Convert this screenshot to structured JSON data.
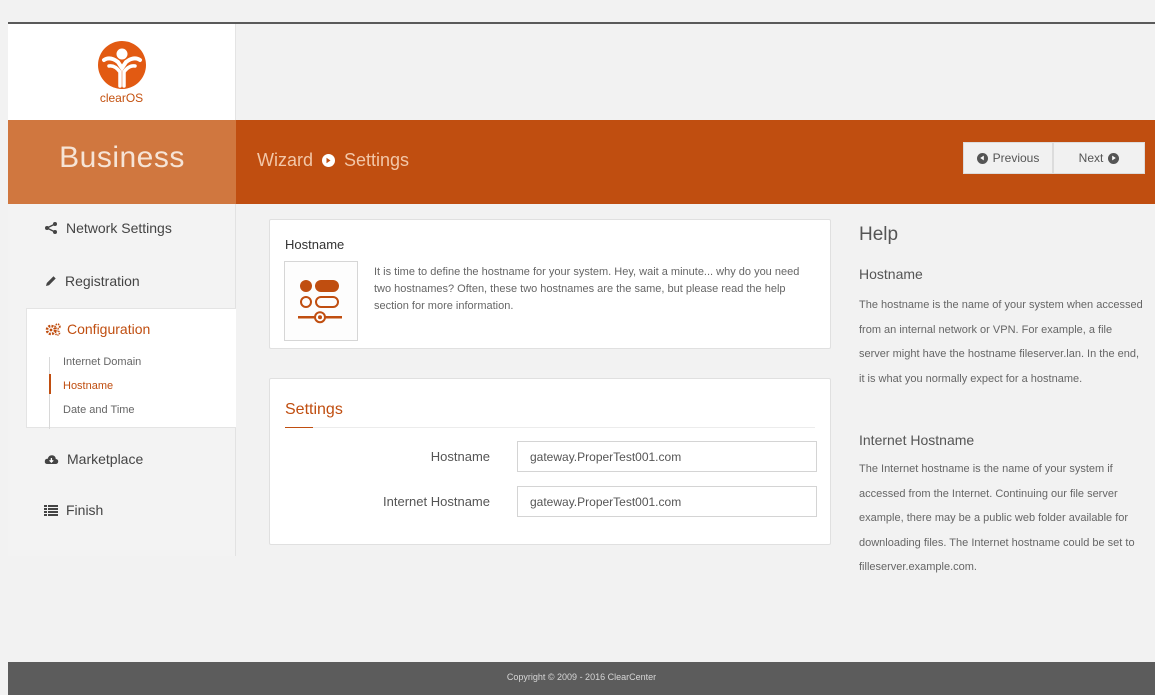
{
  "logo": {
    "text": "clearOS",
    "icon": "clearos-logo"
  },
  "banner": {
    "edition": "Business",
    "breadcrumb": {
      "wizard": "Wizard",
      "separator_icon": "circle-arrow-right-icon",
      "current": "Settings"
    },
    "previous_label": "Previous",
    "next_label": "Next"
  },
  "sidebar": {
    "items": [
      {
        "label": "Network Settings",
        "icon": "share-icon"
      },
      {
        "label": "Registration",
        "icon": "pencil-icon"
      },
      {
        "label": "Configuration",
        "icon": "cogs-icon",
        "active": true
      },
      {
        "label": "Marketplace",
        "icon": "cloud-icon"
      },
      {
        "label": "Finish",
        "icon": "list-icon"
      }
    ],
    "sub_items": [
      {
        "label": "Internet Domain"
      },
      {
        "label": "Hostname",
        "active": true
      },
      {
        "label": "Date and Time"
      }
    ]
  },
  "hostname_card": {
    "title": "Hostname",
    "description": "It is time to define the hostname for your system. Hey, wait a minute... why do you need two hostnames? Often, these two hostnames are the same, but please read the help section for more information."
  },
  "settings_card": {
    "title": "Settings",
    "fields": [
      {
        "label": "Hostname",
        "value": "gateway.ProperTest001.com"
      },
      {
        "label": "Internet Hostname",
        "value": "gateway.ProperTest001.com"
      }
    ]
  },
  "help": {
    "title": "Help",
    "sections": [
      {
        "heading": "Hostname",
        "text": "The hostname is the name of your system when accessed from an internal network or VPN. For example, a file server might have the hostname fileserver.lan. In the end, it is what you normally expect for a hostname."
      },
      {
        "heading": "Internet Hostname",
        "text": "The Internet hostname is the name of your system if accessed from the Internet. Continuing our file server example, there may be a public web folder available for downloading files. The Internet hostname could be set to filleserver.example.com."
      }
    ]
  },
  "footer": {
    "copyright": "Copyright © 2009 - 2016 ClearCenter"
  },
  "colors": {
    "accent": "#c04e10",
    "brand_box": "#d0773f",
    "footer": "#5c5c5c",
    "background": "#f2f2f2"
  }
}
